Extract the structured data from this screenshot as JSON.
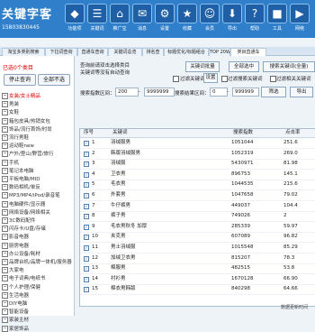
{
  "app": {
    "name": "关键字客",
    "phone": "15803830445"
  },
  "toolbar": [
    {
      "icon": "◆",
      "label": "功能项"
    },
    {
      "icon": "☰",
      "label": "关键词"
    },
    {
      "icon": "⌂",
      "label": "推广宝"
    },
    {
      "icon": "✉",
      "label": "消息"
    },
    {
      "icon": "⚙",
      "label": "设置"
    },
    {
      "icon": "★",
      "label": "收藏"
    },
    {
      "icon": "☺",
      "label": "会员"
    },
    {
      "icon": "⬇",
      "label": "导出"
    },
    {
      "icon": "?",
      "label": "帮助"
    },
    {
      "icon": "■",
      "label": "工具"
    },
    {
      "icon": "▶",
      "label": "网络"
    }
  ],
  "tabs": [
    "淘宝多类别搜索",
    "下拉词查询",
    "直通车查询",
    "关键词总览",
    "排名查",
    "标题优化/标题组合",
    "TOP 20W",
    "类目直通车"
  ],
  "left": {
    "selected": "已选0个类目",
    "stop_btn": "停止查询",
    "clear_btn": "全部不选",
    "categories": [
      {
        "t": "女装/女士精品",
        "red": true
      },
      {
        "t": "男装",
        "red": false
      },
      {
        "t": "女鞋",
        "red": false
      },
      {
        "t": "箱包皮具/热销女包",
        "red": false
      },
      {
        "t": "饰品/流行首饰/时尚",
        "red": false
      },
      {
        "t": "流行男鞋",
        "red": false
      },
      {
        "t": "运动鞋new",
        "red": false
      },
      {
        "t": "户外/登山/野营/旅行",
        "red": false
      },
      {
        "t": "手机",
        "red": false
      },
      {
        "t": "笔记本电脑",
        "red": false
      },
      {
        "t": "平板电脑/MID",
        "red": false
      },
      {
        "t": "数码相机/单反",
        "red": false
      },
      {
        "t": "MP3/MP4/iPod/录音笔",
        "red": false
      },
      {
        "t": "电脑硬件/显示器",
        "red": false
      },
      {
        "t": "网络设备/网络相关",
        "red": false
      },
      {
        "t": "3C数码配件",
        "red": false
      },
      {
        "t": "闪存卡/U盘/存储",
        "red": false
      },
      {
        "t": "影音电器",
        "red": false
      },
      {
        "t": "厨房电器",
        "red": false
      },
      {
        "t": "办公设备/耗材",
        "red": false
      },
      {
        "t": "品牌台机/品牌一体机/服务器",
        "red": false
      },
      {
        "t": "大家电",
        "red": false
      },
      {
        "t": "电子词典/电纸书",
        "red": false
      },
      {
        "t": "个人护理/保健",
        "red": false
      },
      {
        "t": "生活电器",
        "red": false
      },
      {
        "t": "DIY电脑",
        "red": false
      },
      {
        "t": "智能设备",
        "red": false
      },
      {
        "t": "家装主材",
        "red": false
      },
      {
        "t": "家居饰品",
        "red": false
      }
    ]
  },
  "main": {
    "hint1": "查询前请双击选择类目",
    "hint2": "关键词等没有自动查询",
    "btn_query_category": "关键词批量",
    "btn_select_all": "全部选中",
    "btn_search": "搜索关键词(全量)",
    "filter_label": "过滤关键词",
    "set_label": "设置",
    "filter_other": "过滤搜索关键词",
    "filter_self": "过滤相关关键词",
    "search_label": "搜索指数区间：",
    "search_from": "200",
    "search_to": "9999999",
    "order_label": "搜索结果区间：",
    "order_from": "0",
    "order_to": "999999",
    "btn_filter": "筛选",
    "btn_export": "导出",
    "columns": [
      "序号",
      "关键词",
      "搜索指数",
      "点击率"
    ],
    "rows": [
      {
        "no": "1",
        "kw": "羽绒服男",
        "idx": "1051044",
        "rate": "251.6"
      },
      {
        "no": "2",
        "kw": "韩版羽绒服男",
        "idx": "1052319",
        "rate": "269.0"
      },
      {
        "no": "3",
        "kw": "羽绒服",
        "idx": "5430971",
        "rate": "81.98"
      },
      {
        "no": "4",
        "kw": "卫衣男",
        "idx": "896753",
        "rate": "145.1"
      },
      {
        "no": "5",
        "kw": "毛衣男",
        "idx": "1044535",
        "rate": "215.6"
      },
      {
        "no": "6",
        "kw": "外套男",
        "idx": "1047658",
        "rate": "79.02"
      },
      {
        "no": "7",
        "kw": "牛仔裤男",
        "idx": "449037",
        "rate": "104.4"
      },
      {
        "no": "8",
        "kw": "裤子男",
        "idx": "749026",
        "rate": "2"
      },
      {
        "no": "9",
        "kw": "毛衣男秋冬 加厚",
        "idx": "285339",
        "rate": "59.97"
      },
      {
        "no": "10",
        "kw": "夹克男",
        "idx": "607089",
        "rate": "96.82"
      },
      {
        "no": "11",
        "kw": "男士羽绒服",
        "idx": "1015548",
        "rate": "85.29"
      },
      {
        "no": "12",
        "kw": "加绒卫衣男",
        "idx": "815207",
        "rate": "78.3"
      },
      {
        "no": "13",
        "kw": "棉服男",
        "idx": "482515",
        "rate": "53.8"
      },
      {
        "no": "14",
        "kw": "衬衫男",
        "idx": "1670128",
        "rate": "66.90"
      },
      {
        "no": "15",
        "kw": "棉衣男韩版",
        "idx": "840298",
        "rate": "64.66"
      }
    ],
    "bottom_text": "数据更新时间"
  }
}
